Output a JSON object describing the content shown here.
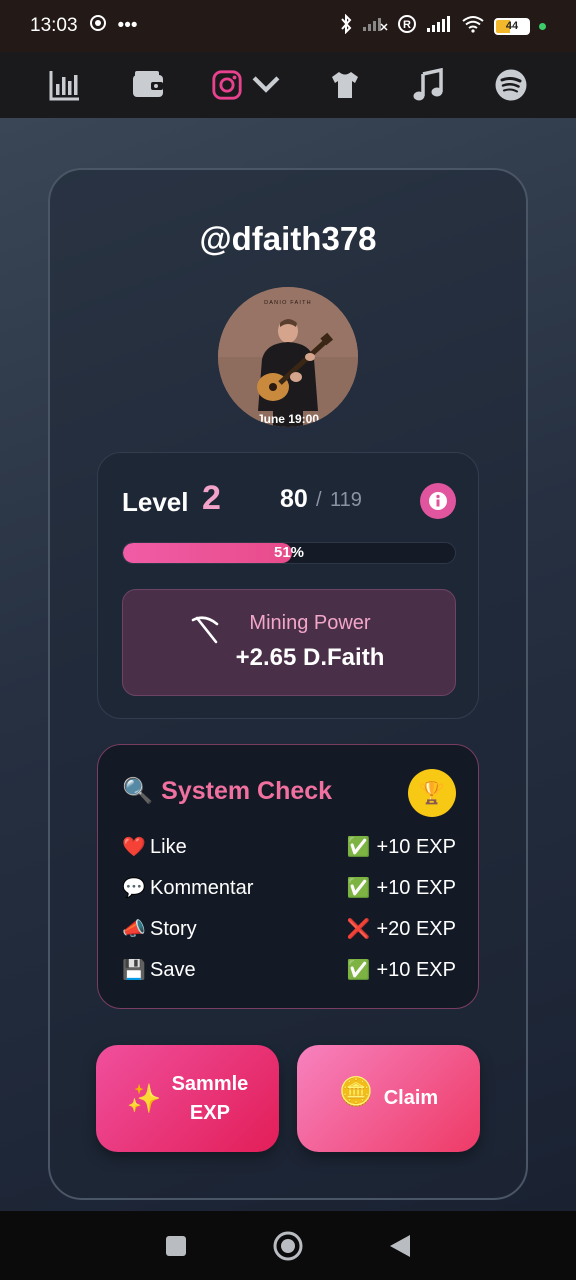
{
  "status_bar": {
    "time": "13:03",
    "more": "•••",
    "battery": "44"
  },
  "top_nav": {
    "items": [
      {
        "icon": "bar-chart-icon"
      },
      {
        "icon": "wallet-icon"
      },
      {
        "icon": "instagram-icon",
        "active": true
      },
      {
        "icon": "tshirt-icon"
      },
      {
        "icon": "music-note-icon"
      },
      {
        "icon": "spotify-icon"
      }
    ]
  },
  "profile": {
    "username": "@dfaith378",
    "avatar_poster_title": "DANIO FAITH",
    "avatar_caption": "June 19:00"
  },
  "level": {
    "label": "Level",
    "number": "2",
    "exp_current": "80",
    "separator": "/",
    "exp_max": "119",
    "progress_percent": 51,
    "progress_label": "51%"
  },
  "mining": {
    "label": "Mining Power",
    "value": "+2.65 D.Faith"
  },
  "system_check": {
    "title_emoji": "🔍",
    "title": "System Check",
    "trophy": "🏆",
    "rows": [
      {
        "emoji": "❤️",
        "label": "Like",
        "mark": "✅",
        "reward": "+10 EXP"
      },
      {
        "emoji": "💬",
        "label": "Kommentar",
        "mark": "✅",
        "reward": "+10 EXP"
      },
      {
        "emoji": "📣",
        "label": "Story",
        "mark": "❌",
        "reward": "+20 EXP"
      },
      {
        "emoji": "💾",
        "label": "Save",
        "mark": "✅",
        "reward": "+10 EXP"
      }
    ]
  },
  "buttons": {
    "sammle_emoji": "✨",
    "sammle_line1": "Sammle",
    "sammle_line2": "EXP",
    "claim_emoji": "🪙",
    "claim_label": "Claim"
  },
  "colors": {
    "accent_pink": "#e0559e",
    "trophy_yellow": "#f8c914",
    "status_green": "#3ccc6a"
  }
}
